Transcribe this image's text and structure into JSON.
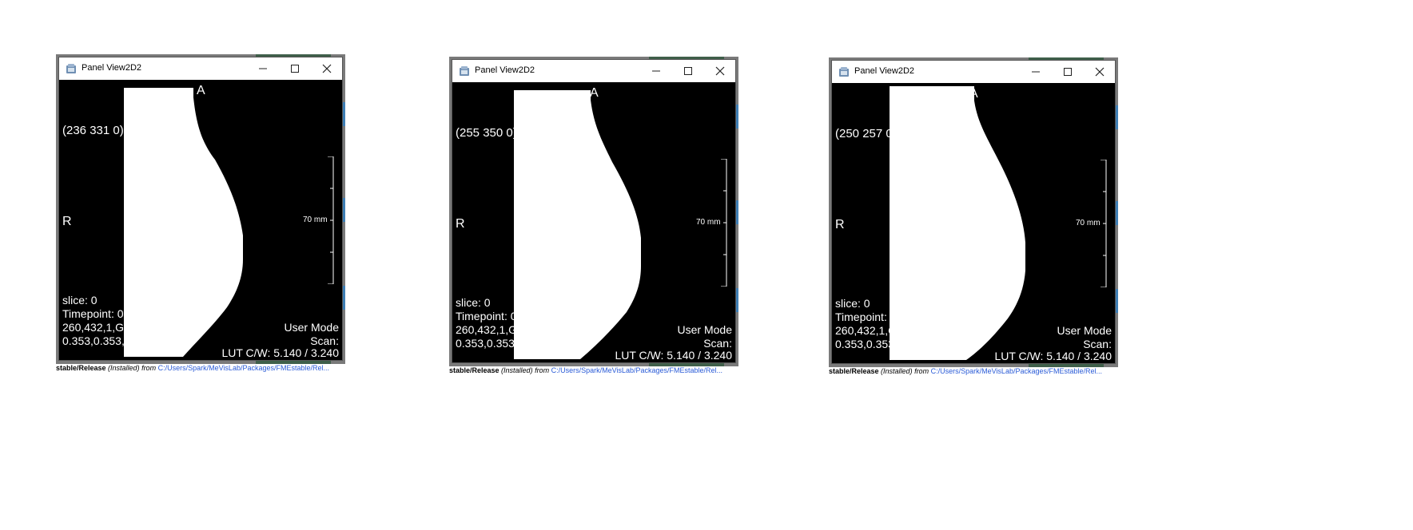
{
  "windows": [
    {
      "title": "Panel View2D2",
      "orientation_top": "A",
      "orientation_left": "R",
      "pixel_readout": "(236 331 0): 0.0000",
      "scale_label": "70 mm",
      "slice": "slice:  0",
      "timepoint": "Timepoint: 0",
      "dims": "260,432,1,Gray,1",
      "spacing": "0.353,0.353,1.000",
      "mode": "User Mode",
      "scan": "Scan:",
      "lut": "LUT C/W: 5.140 / 3.240",
      "status_prefix": "stable/Release",
      "status_installed": " (Installed) from ",
      "status_path": "C:/Users/Spark/MeVisLab/Packages/FMEstable/Rel..."
    },
    {
      "title": "Panel View2D2",
      "orientation_top": "A",
      "orientation_left": "R",
      "pixel_readout": "(255 350 0): 0.0000",
      "scale_label": "70 mm",
      "slice": "slice:  0",
      "timepoint": "Timepoint: 0",
      "dims": "260,432,1,Gray,1",
      "spacing": "0.353,0.353,1.000",
      "mode": "User Mode",
      "scan": "Scan:",
      "lut": "LUT C/W: 5.140 / 3.240",
      "status_prefix": "stable/Release",
      "status_installed": " (Installed) from ",
      "status_path": "C:/Users/Spark/MeVisLab/Packages/FMEstable/Rel..."
    },
    {
      "title": "Panel View2D2",
      "orientation_top": "A",
      "orientation_left": "R",
      "pixel_readout": "(250 257 0): 0.0000",
      "scale_label": "70 mm",
      "slice": "slice:  0",
      "timepoint": "Timepoint: 0",
      "dims": "260,432,1,Gray,1",
      "spacing": "0.353,0.353,1.000",
      "mode": "User Mode",
      "scan": "Scan:",
      "lut": "LUT C/W: 5.140 / 3.240",
      "status_prefix": "stable/Release",
      "status_installed": " (Installed) from ",
      "status_path": "C:/Users/Spark/MeVisLab/Packages/FMEstable/Rel..."
    }
  ],
  "icons": {
    "app": "app-icon",
    "minimize": "minimize-icon",
    "maximize": "maximize-icon",
    "close": "close-icon"
  },
  "colors": {
    "viewer_background": "#000000",
    "mask_foreground": "#ffffff",
    "titlebar": "#ffffff",
    "path_link": "#2a5bd7"
  }
}
